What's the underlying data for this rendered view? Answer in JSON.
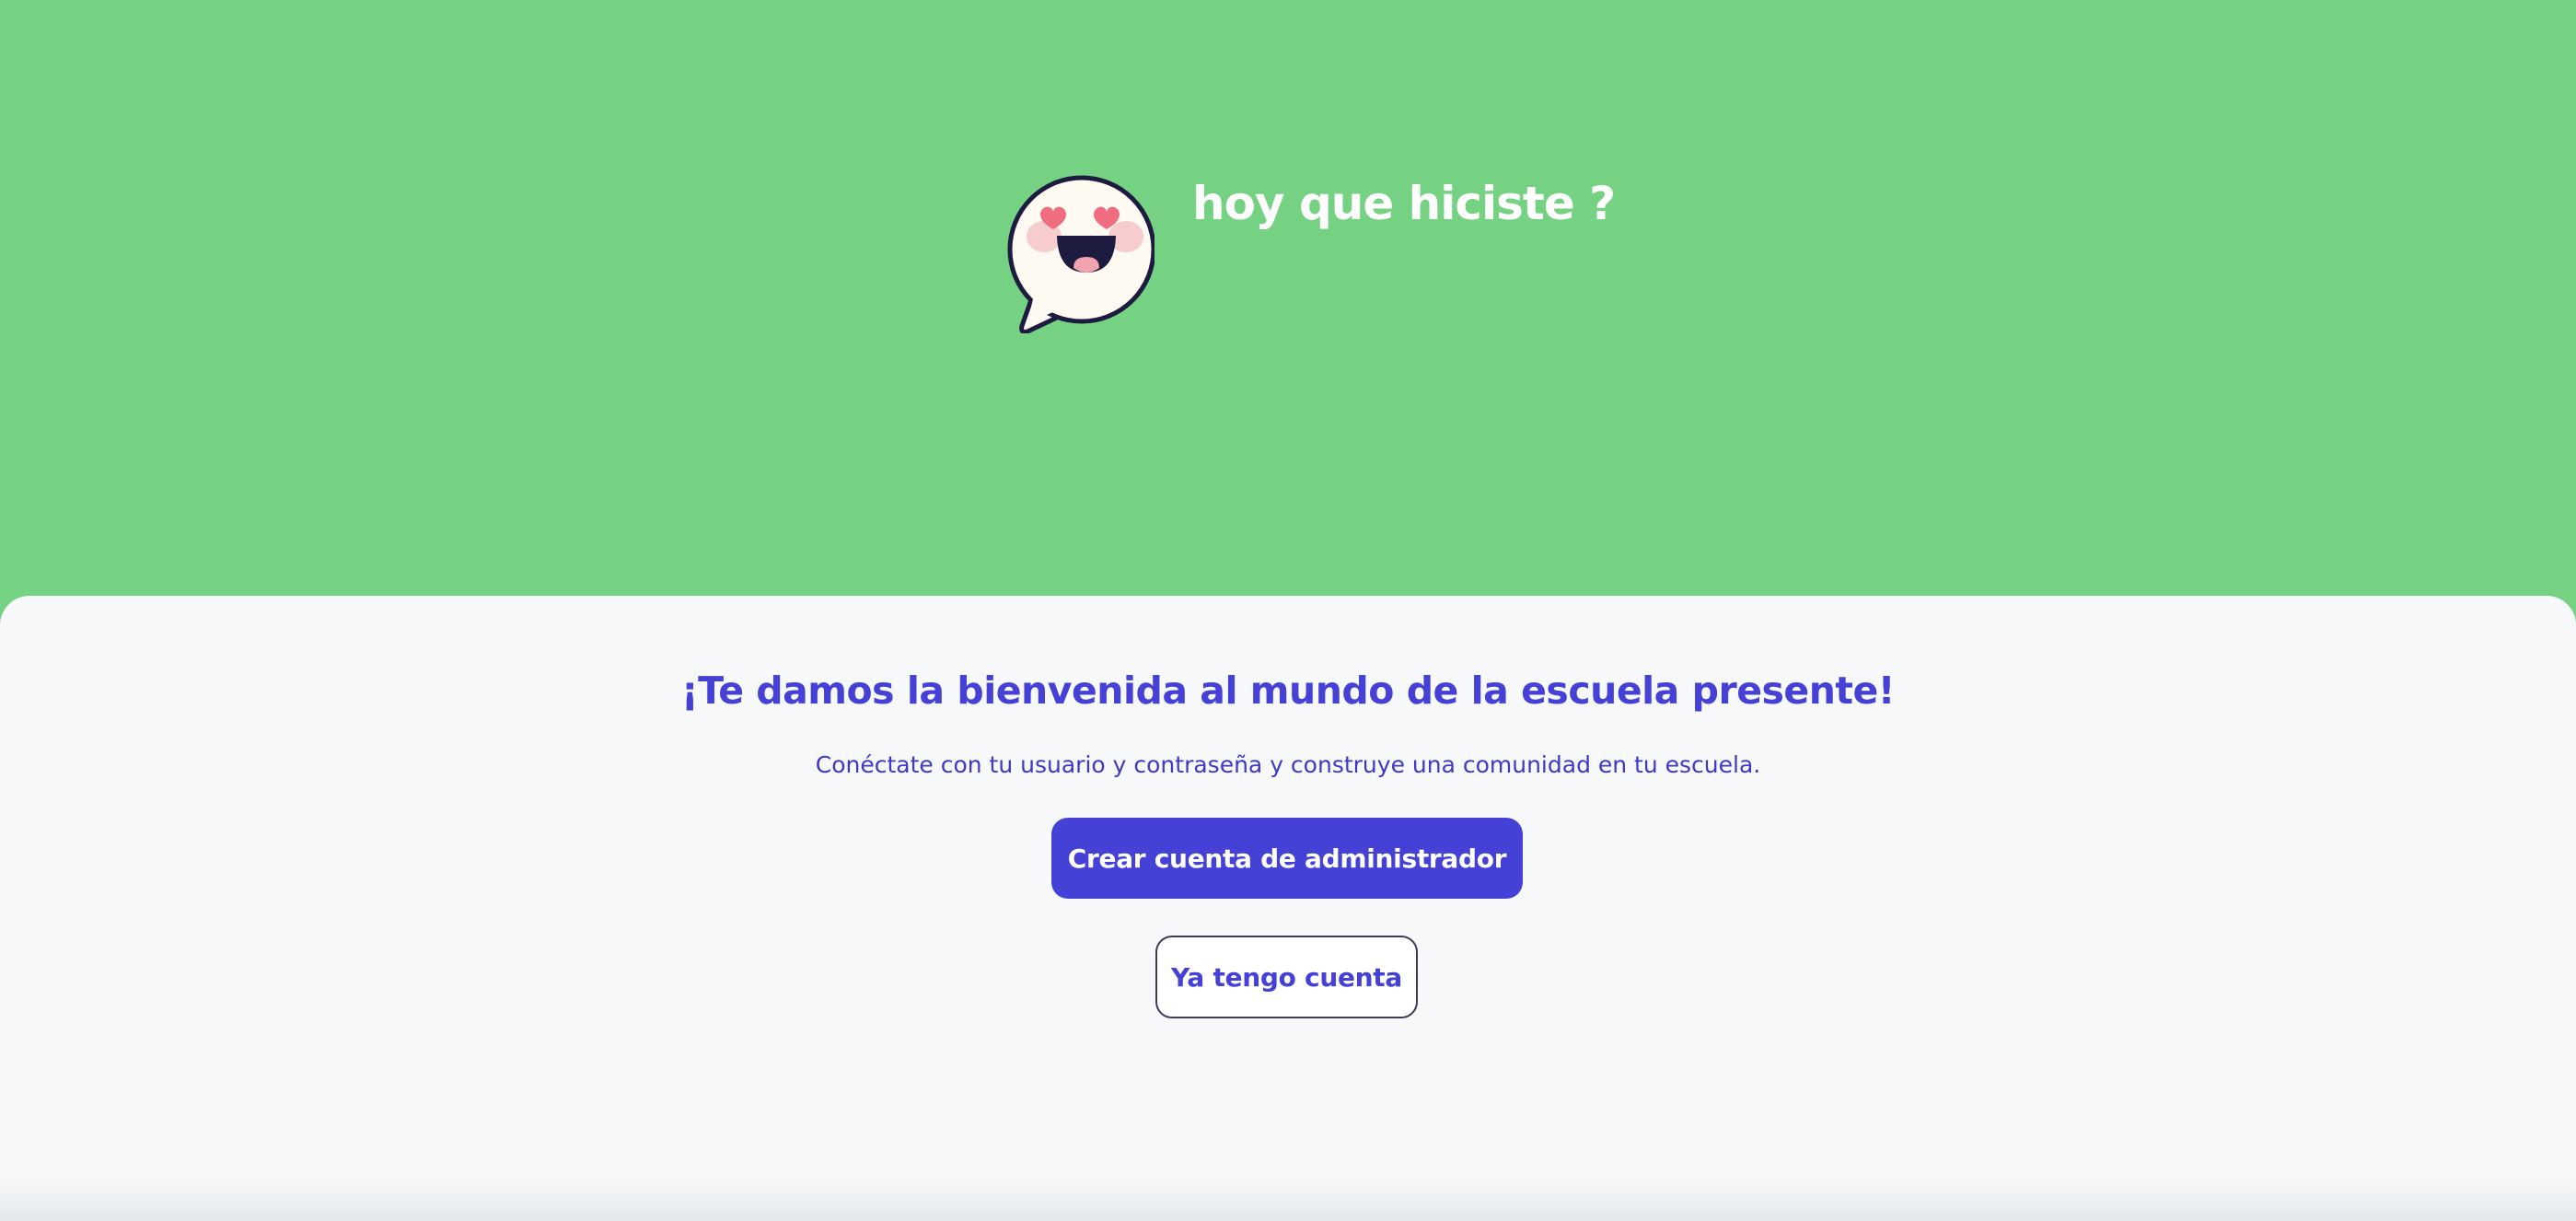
{
  "header": {
    "logo": "smiling-speech-bubble-heart-eyes-logo",
    "title": "hoy que hiciste ?"
  },
  "welcome": {
    "title": "¡Te damos la bienvenida al mundo de la escuela presente!",
    "subtitle": "Conéctate con tu usuario y contraseña y construye una comunidad en tu escuela.",
    "create_admin_label": "Crear cuenta de administrador",
    "have_account_label": "Ya tengo cuenta"
  },
  "colors": {
    "hero_background": "#74d282",
    "card_background": "#f6f8fa",
    "accent": "#4540d6",
    "heart": "#f06d80",
    "outline": "#1d1b3f"
  }
}
